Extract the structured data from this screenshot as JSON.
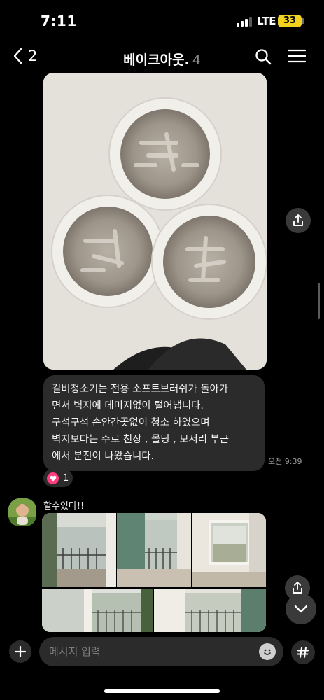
{
  "status_bar": {
    "time": "7:11",
    "network": "LTE",
    "battery": "33"
  },
  "header": {
    "back_count": "2",
    "title": "베이크아웃.",
    "member_count": "4"
  },
  "message": {
    "lines": [
      "컬비청소기는 전용 소프트브러쉬가 돌아가",
      "면서 벽지에 데미지없이 털어냅니다.",
      "구석구석 손안간곳없이 청소 하였으며",
      "벽지보다는 주로 천장 , 몰딩 , 모서리 부근",
      "에서 분진이 나왔습니다."
    ],
    "time": "오전 9:39",
    "reaction_count": "1"
  },
  "sender": {
    "name": "할수있다!!"
  },
  "input": {
    "placeholder": "메시지 입력"
  },
  "icons": {
    "back": "chevron-left-icon",
    "search": "search-icon",
    "menu": "hamburger-menu-icon",
    "share": "share-icon",
    "reaction": "heart-icon",
    "scroll": "chevron-down-icon",
    "attach": "plus-icon",
    "emoji": "emoji-icon",
    "hashtag": "hashtag-icon"
  },
  "colors": {
    "background": "#000000",
    "bubble": "#2b2b2b",
    "reaction": "#ff3e7f",
    "battery": "#f2d21f"
  }
}
